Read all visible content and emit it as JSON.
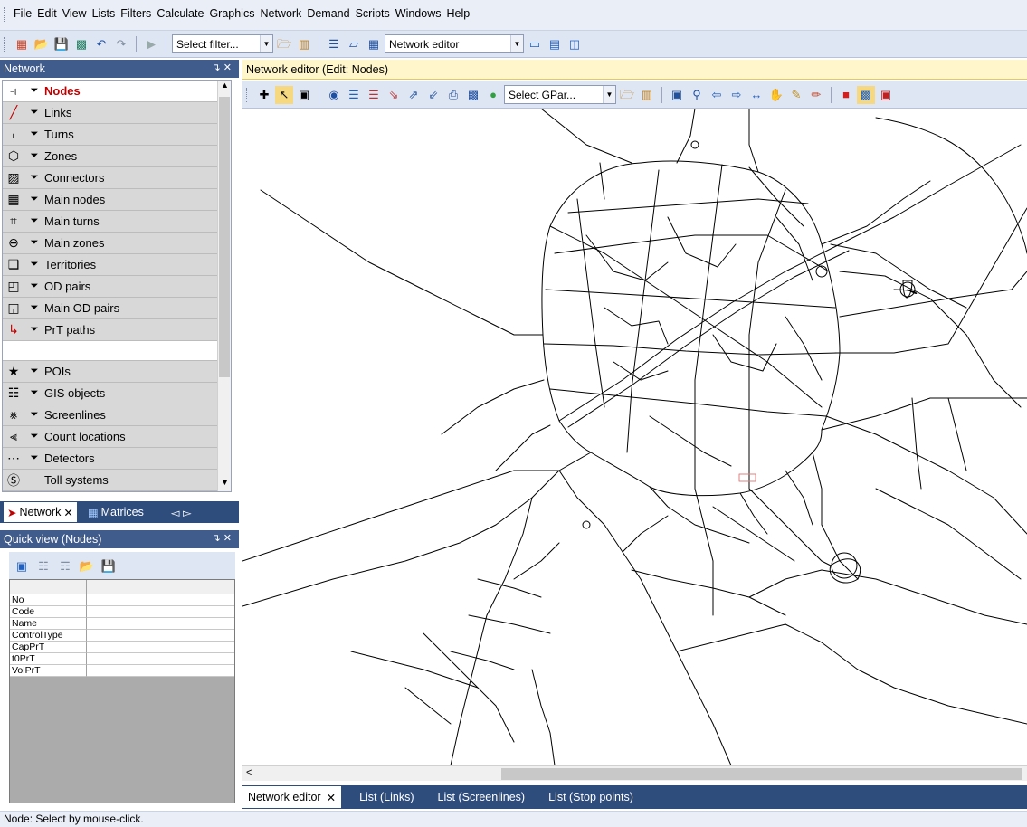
{
  "menu": [
    "File",
    "Edit",
    "View",
    "Lists",
    "Filters",
    "Calculate",
    "Graphics",
    "Network",
    "Demand",
    "Scripts",
    "Windows",
    "Help"
  ],
  "main_toolbar": {
    "filter_combo": "Select filter...",
    "view_combo": "Network editor"
  },
  "network_panel": {
    "title": "Network",
    "items": [
      {
        "label": "Nodes",
        "icon": "node-icon",
        "filter": true
      },
      {
        "label": "Links",
        "icon": "link-icon",
        "filter": true
      },
      {
        "label": "Turns",
        "icon": "turn-icon",
        "filter": true
      },
      {
        "label": "Zones",
        "icon": "zone-icon",
        "filter": true
      },
      {
        "label": "Connectors",
        "icon": "connector-icon",
        "filter": true
      },
      {
        "label": "Main nodes",
        "icon": "main-node-icon",
        "filter": true
      },
      {
        "label": "Main turns",
        "icon": "main-turn-icon",
        "filter": true
      },
      {
        "label": "Main zones",
        "icon": "main-zone-icon",
        "filter": true
      },
      {
        "label": "Territories",
        "icon": "territory-icon",
        "filter": true
      },
      {
        "label": "OD pairs",
        "icon": "od-pair-icon",
        "filter": true
      },
      {
        "label": "Main OD pairs",
        "icon": "main-od-pair-icon",
        "filter": true
      },
      {
        "label": "PrT paths",
        "icon": "prt-path-icon",
        "filter": true
      }
    ],
    "items2": [
      {
        "label": "POIs",
        "icon": "star-icon",
        "filter": true
      },
      {
        "label": "GIS objects",
        "icon": "gis-icon",
        "filter": true
      },
      {
        "label": "Screenlines",
        "icon": "screenline-icon",
        "filter": true
      },
      {
        "label": "Count locations",
        "icon": "count-location-icon",
        "filter": true
      },
      {
        "label": "Detectors",
        "icon": "detector-icon",
        "filter": true
      },
      {
        "label": "Toll systems",
        "icon": "toll-icon",
        "filter": false
      }
    ]
  },
  "left_tabs": [
    {
      "label": "Network",
      "active": true
    },
    {
      "label": "Matrices",
      "active": false
    }
  ],
  "quick_view": {
    "title": "Quick view (Nodes)",
    "rows": [
      "No",
      "Code",
      "Name",
      "ControlType",
      "CapPrT",
      "t0PrT",
      "VolPrT"
    ]
  },
  "editor": {
    "title": "Network editor (Edit: Nodes)",
    "gpar_combo": "Select GPar..."
  },
  "editor_tabs": [
    {
      "label": "Network editor",
      "active": true
    },
    {
      "label": "List (Links)",
      "active": false
    },
    {
      "label": "List (Screenlines)",
      "active": false
    },
    {
      "label": "List (Stop points)",
      "active": false
    }
  ],
  "status": "Node: Select by mouse-click."
}
